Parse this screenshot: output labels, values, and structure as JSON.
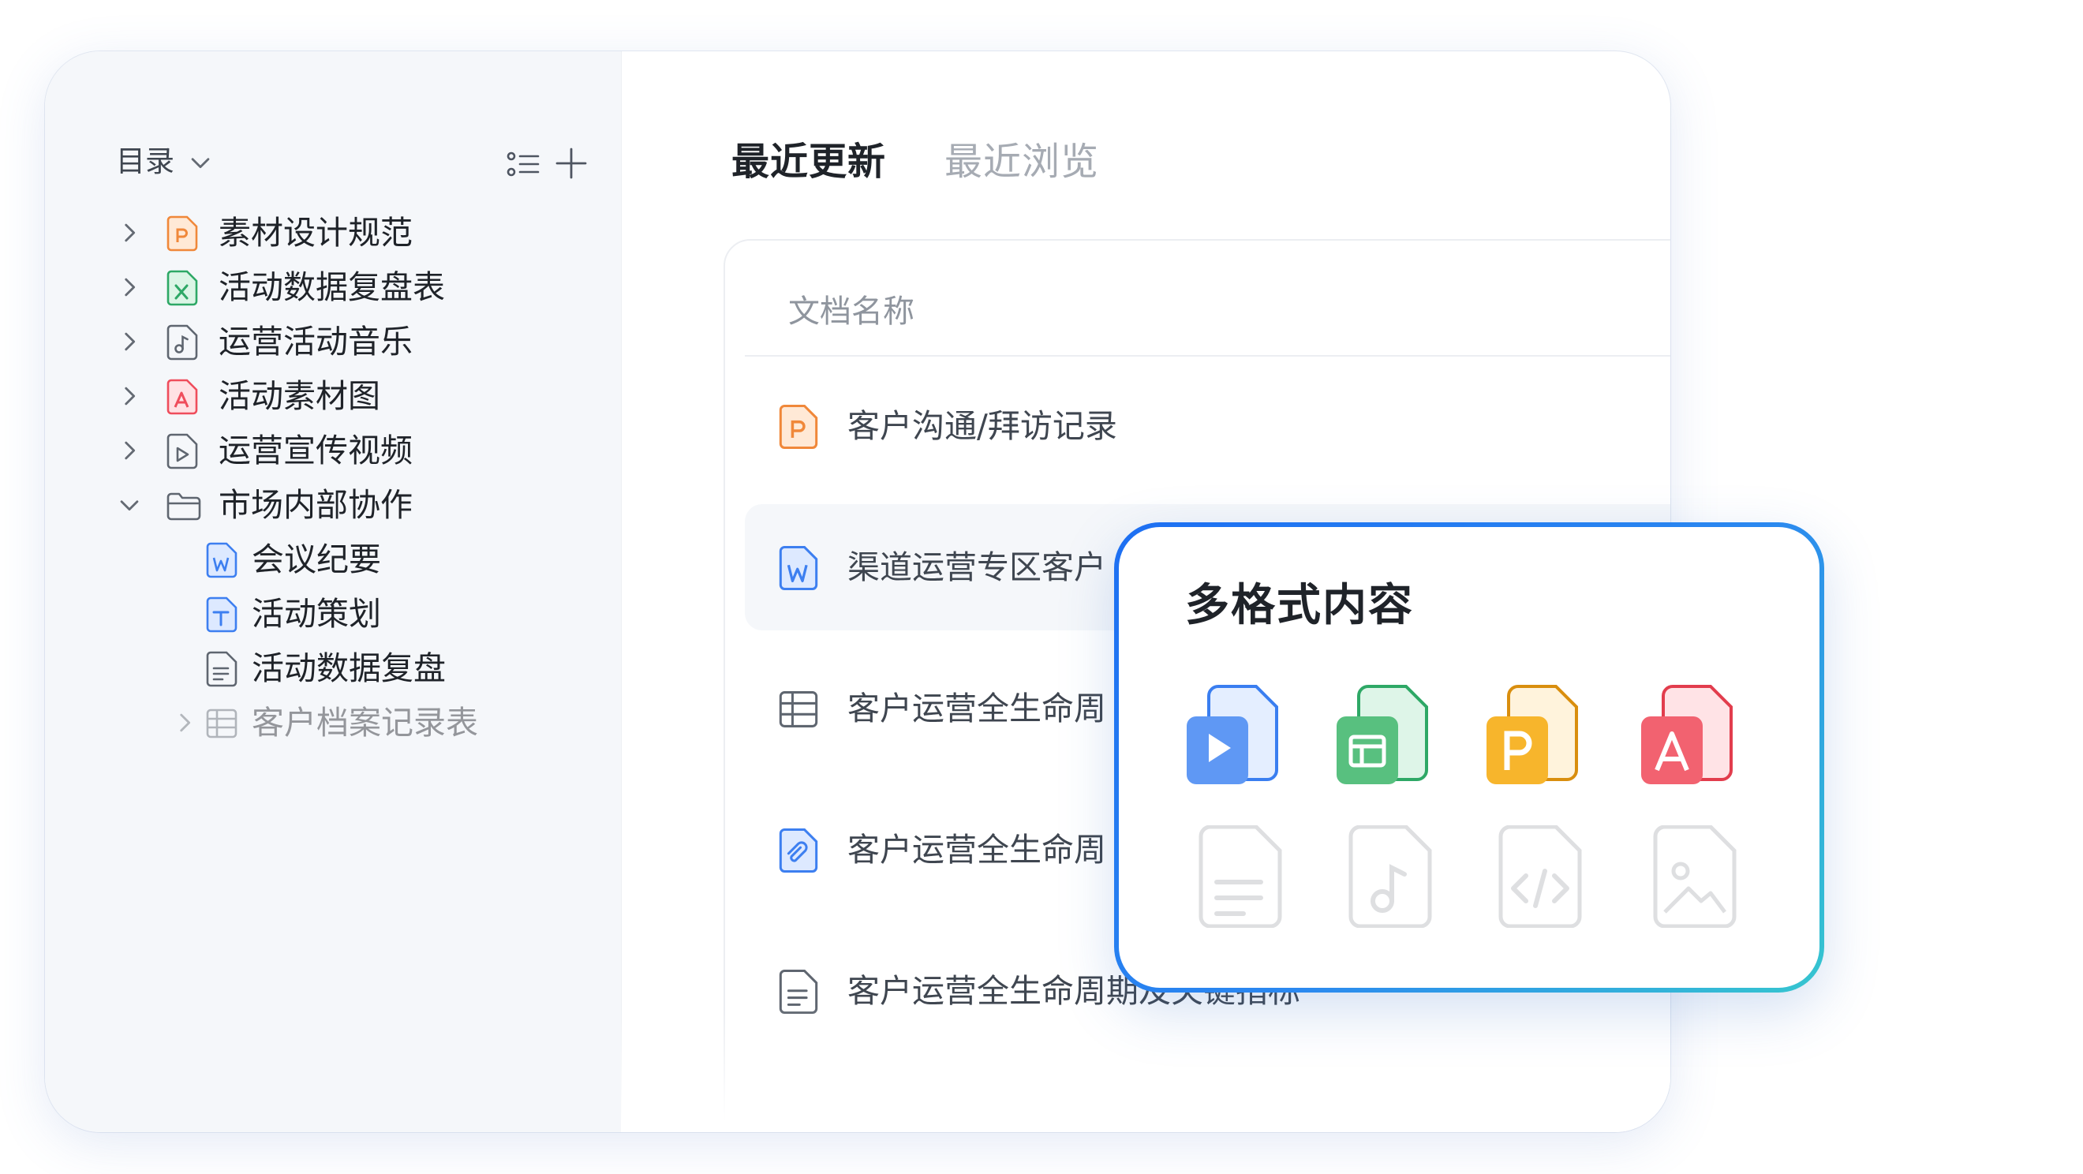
{
  "sidebar": {
    "title": "目录",
    "items": [
      {
        "label": "素材设计规范",
        "icon": "ppt-file-icon",
        "expanded": false
      },
      {
        "label": "活动数据复盘表",
        "icon": "excel-file-icon",
        "expanded": false
      },
      {
        "label": "运营活动音乐",
        "icon": "music-file-icon",
        "expanded": false
      },
      {
        "label": "活动素材图",
        "icon": "pdf-file-icon",
        "expanded": false
      },
      {
        "label": "运营宣传视频",
        "icon": "video-file-icon",
        "expanded": false
      },
      {
        "label": "市场内部协作",
        "icon": "folder-icon",
        "expanded": true
      },
      {
        "label": "会议纪要",
        "icon": "word-file-icon"
      },
      {
        "label": "活动策划",
        "icon": "text-file-icon"
      },
      {
        "label": "活动数据复盘",
        "icon": "doc-file-icon"
      },
      {
        "label": "客户档案记录表",
        "icon": "table-file-icon",
        "expanded": false
      }
    ]
  },
  "tabs": [
    {
      "label": "最近更新",
      "active": true
    },
    {
      "label": "最近浏览",
      "active": false
    }
  ],
  "docs": {
    "header": "文档名称",
    "rows": [
      {
        "name": "客户沟通/拜访记录",
        "icon": "ppt-file-icon"
      },
      {
        "name": "渠道运营专区客户",
        "icon": "word-file-icon",
        "selected": true
      },
      {
        "name": "客户运营全生命周",
        "icon": "table-file-icon"
      },
      {
        "name": "客户运营全生命周",
        "icon": "link-file-icon"
      },
      {
        "name": "客户运营全生命周期及关键指标",
        "icon": "doc-file-icon"
      }
    ]
  },
  "popup": {
    "title": "多格式内容",
    "formats": [
      {
        "icon": "video-format-icon",
        "color": "#4a8df5"
      },
      {
        "icon": "sheet-format-icon",
        "color": "#34b36a"
      },
      {
        "icon": "ppt-format-icon",
        "color": "#f4a71c"
      },
      {
        "icon": "pdf-format-icon",
        "color": "#ef5460"
      },
      {
        "icon": "document-format-icon"
      },
      {
        "icon": "music-format-icon"
      },
      {
        "icon": "code-format-icon"
      },
      {
        "icon": "image-format-icon"
      }
    ]
  },
  "colors": {
    "accent_blue": "#2b7cf2",
    "popup_border_start": "#1d6ff2",
    "popup_border_end": "#36c6cf",
    "sidebar_bg": "#f5f7fa"
  }
}
